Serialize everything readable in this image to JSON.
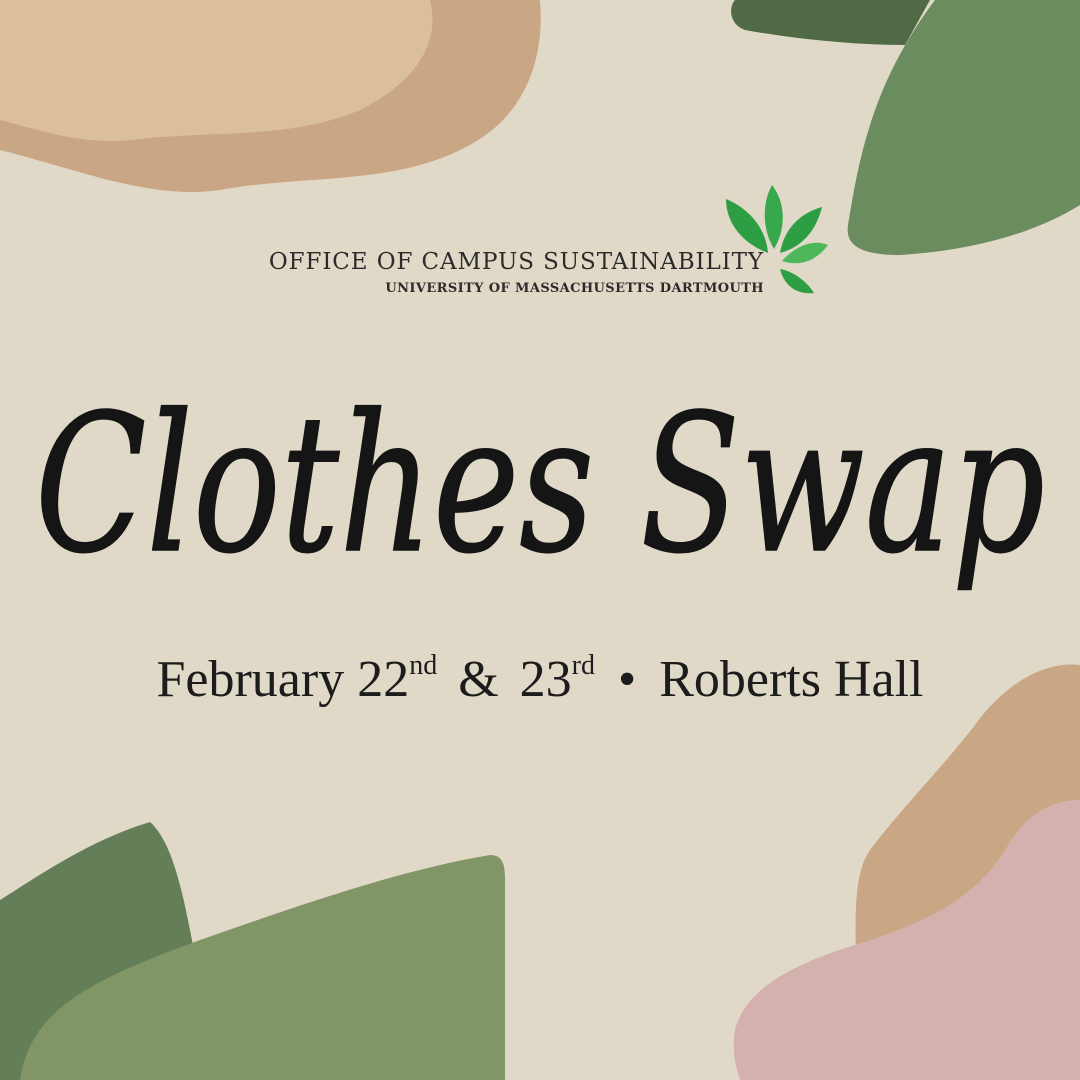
{
  "header": {
    "org_name": "OFFICE OF CAMPUS SUSTAINABILITY",
    "org_subtitle": "UNIVERSITY OF MASSACHUSETTS DARTMOUTH",
    "logo_icon": "leaf-cluster-icon"
  },
  "title": "Clothes Swap",
  "details": {
    "month": "February",
    "day1": "22",
    "day1_suffix": "nd",
    "amp": "&",
    "day2": "23",
    "day2_suffix": "rd",
    "separator": "•",
    "location": "Roberts Hall"
  },
  "colors": {
    "background": "#e0d9c7",
    "tan": "#c9a684",
    "light_tan": "#dbbf9d",
    "sage_green": "#6b8c5f",
    "dark_green": "#4f6a45",
    "olive_green": "#819566",
    "mauve_pink": "#d4b1ae",
    "leaf_green": "#2e9e45"
  }
}
